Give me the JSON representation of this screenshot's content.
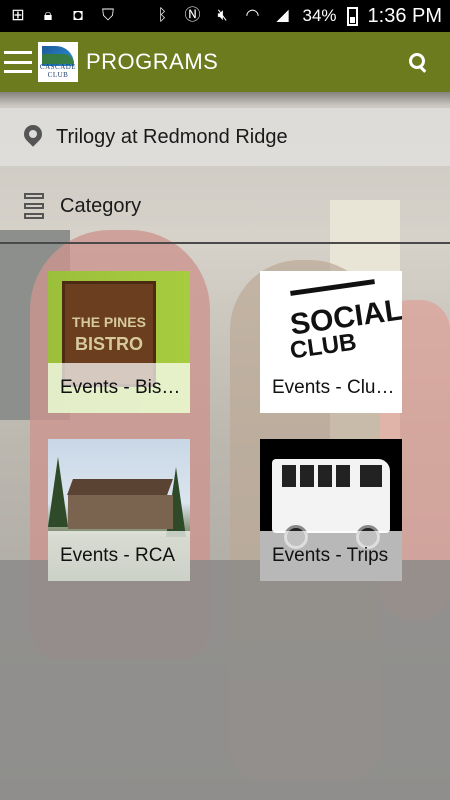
{
  "status_bar": {
    "battery_percent": "34%",
    "time": "1:36 PM"
  },
  "app_bar": {
    "title": "PROGRAMS",
    "logo_text": "CASCADE CLUB"
  },
  "location": {
    "label": "Trilogy at Redmond Ridge"
  },
  "category": {
    "label": "Category"
  },
  "tiles": [
    {
      "label": "Events - Bis…",
      "image_text": [
        "THE PINES",
        "BISTRO"
      ]
    },
    {
      "label": "Events - Clu…",
      "image_text": [
        "SOCIAL",
        "CLUB"
      ]
    },
    {
      "label": "Events - RCA"
    },
    {
      "label": "Events - Trips"
    }
  ],
  "colors": {
    "app_bar": "#6b7b1e",
    "status_bar": "#000000"
  }
}
